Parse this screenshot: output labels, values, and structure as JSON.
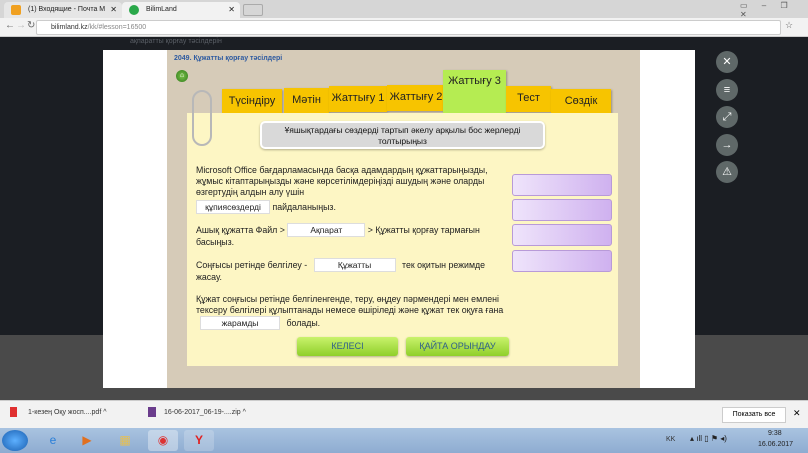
{
  "browser": {
    "tabs": [
      {
        "label": "(1) Входящие - Почта М"
      },
      {
        "label": "BilimLand"
      }
    ],
    "url_host": "bilimland.kz",
    "url_path": "/kk/#lesson=16500"
  },
  "background_text": "ақпаратты қорғау тәсілдерін",
  "lesson": {
    "title": "2049. Құжатты қорғау тәсілдері",
    "tabs": [
      "Түсіндіру",
      "Мәтін",
      "Жаттығу 1",
      "Жаттығу 2",
      "Жаттығу 3",
      "Тест",
      "Сөздік"
    ],
    "active_tab": "Жаттығу 3",
    "instruction": "Ұяшықтардағы сөздерді тартып әкелу арқылы бос жерлерді толтырыңыз",
    "paragraphs": [
      {
        "before": "Microsoft Office бағдарламасында басқа адамдардың құжаттарыңызды, жұмыс кітаптарыңызды және көрсетілімдеріңізді ашудың және оларды өзгертудің алдын алу үшін",
        "blank": "құпиясөздерді",
        "after": "пайдаланыңыз."
      },
      {
        "before": "Ашық құжатта Файл >",
        "blank": "Ақпарат",
        "after": "> Құжатты қорғау тармағын басыңыз."
      },
      {
        "before": "Соңғысы ретінде белгілеу -",
        "blank": "Құжатты",
        "after": "тек оқитын режимде жасау."
      },
      {
        "before": "Құжат соңғысы ретінде белгіленгенде, теру, өңдеу пәрмендері мен емлені тексеру белгілері құлыптанады немесе өшіріледі және құжат тек оқуға ғана",
        "blank": "жарамды",
        "after": "болады."
      }
    ],
    "next_label": "КЕЛЕСІ",
    "retry_label": "ҚАЙТА ОРЫНДАУ"
  },
  "side_buttons": [
    "close-icon",
    "menu-icon",
    "expand-icon",
    "arrow-right-icon",
    "warning-icon"
  ],
  "downloads": [
    {
      "name": "1-кезең Оқу жосп....pdf"
    },
    {
      "name": "16-06-2017_06-19-....zip"
    }
  ],
  "show_all": "Показать все",
  "tray": {
    "lang": "KK",
    "time": "9:38",
    "date": "16.06.2017"
  }
}
